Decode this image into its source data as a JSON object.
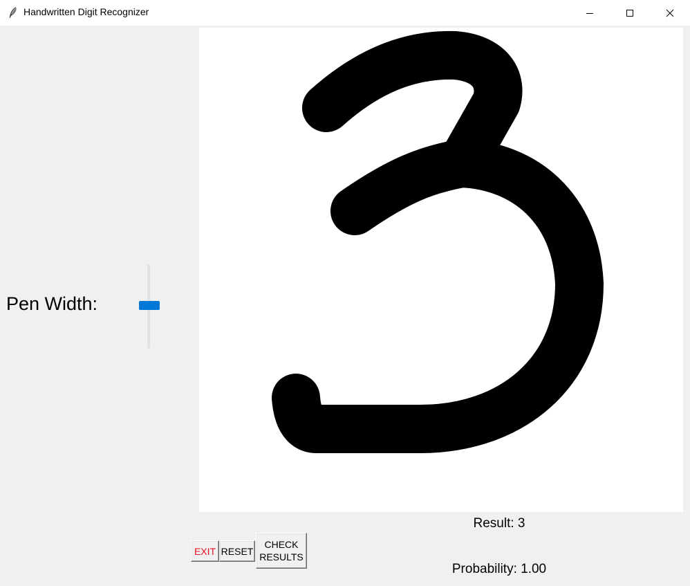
{
  "window": {
    "title": "Handwritten Digit Recognizer",
    "icon": "feather-icon",
    "controls": [
      "minimize-icon",
      "maximize-icon",
      "close-icon"
    ]
  },
  "left_panel": {
    "pen_width_label": "Pen Width:"
  },
  "canvas": {
    "background": "#ffffff",
    "stroke_color": "#000000",
    "drawn_content": "3"
  },
  "buttons": {
    "exit_label": "EXIT",
    "reset_label": "RESET",
    "check_label": "CHECK\nRESULTS"
  },
  "results": {
    "result_text": "Result: 3",
    "probability_text": "Probability: 1.00"
  },
  "colors": {
    "accent": "#0078d7",
    "exit_text": "#e81123",
    "background": "#f0f0f0"
  }
}
